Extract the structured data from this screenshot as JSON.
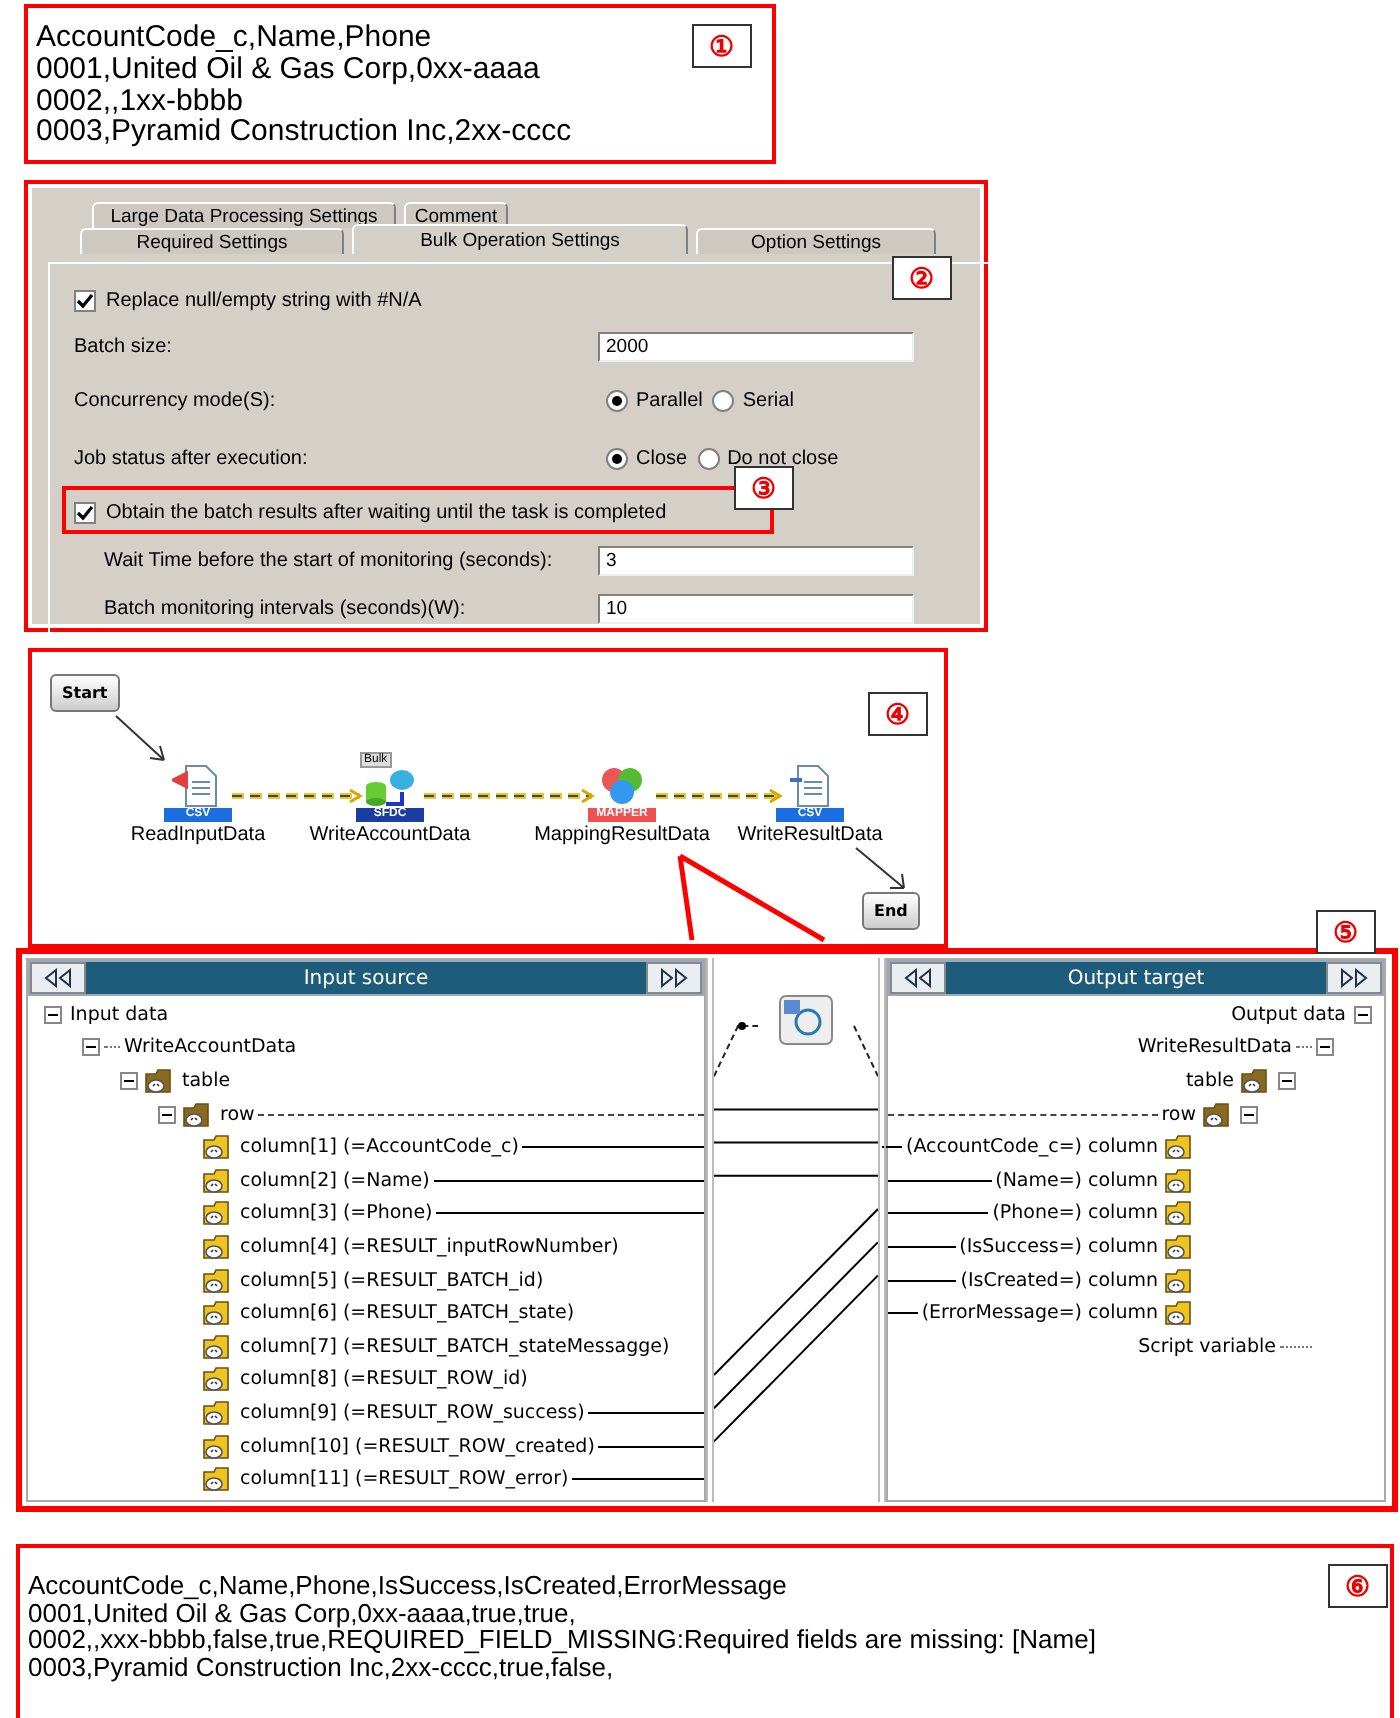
{
  "input_csv": {
    "badge": "①",
    "lines": [
      "AccountCode_c,Name,Phone",
      "0001,United Oil & Gas Corp,0xx-aaaa",
      "0002,,1xx-bbbb",
      "0003,Pyramid Construction Inc,2xx-cccc"
    ]
  },
  "settings": {
    "badge": "②",
    "tabs_back": [
      {
        "label": "Large Data Processing Settings",
        "selected": false
      },
      {
        "label": "Comment",
        "selected": false
      }
    ],
    "tabs_front": [
      {
        "label": "Required Settings",
        "selected": false
      },
      {
        "label": "Bulk Operation Settings",
        "selected": true
      },
      {
        "label": "Option Settings",
        "selected": false
      }
    ],
    "replace_null": {
      "label": "Replace null/empty string with #N/A",
      "checked": true
    },
    "batch_size": {
      "label": "Batch size:",
      "value": "2000"
    },
    "concurrency": {
      "label": "Concurrency mode(S):",
      "options": [
        {
          "label": "Parallel",
          "selected": true
        },
        {
          "label": "Serial",
          "selected": false
        }
      ]
    },
    "job_status": {
      "label": "Job status after execution:",
      "options": [
        {
          "label": "Close",
          "selected": true
        },
        {
          "label": "Do not close",
          "selected": false
        }
      ]
    },
    "obtain_results": {
      "label": "Obtain the batch results after waiting until the task is completed",
      "checked": true,
      "badge": "③"
    },
    "wait_time": {
      "label": "Wait Time before the start of monitoring (seconds):",
      "value": "3"
    },
    "monitor_interval": {
      "label": "Batch monitoring intervals (seconds)(W):",
      "value": "10"
    }
  },
  "flow": {
    "badge": "④",
    "start": "Start",
    "end": "End",
    "nodes": [
      {
        "name": "ReadInputData",
        "tag": "CSV",
        "kind": "csv-read"
      },
      {
        "name": "WriteAccountData",
        "tag": "SFDC",
        "kind": "sfdc",
        "extra": "Bulk"
      },
      {
        "name": "MappingResultData",
        "tag": "MAPPER",
        "kind": "mapper"
      },
      {
        "name": "WriteResultData",
        "tag": "CSV",
        "kind": "csv-write"
      }
    ]
  },
  "mapper": {
    "badge": "⑤",
    "input": {
      "title": "Input source",
      "tree": [
        {
          "label": "Input data",
          "kind": "root",
          "children": [
            {
              "label": "WriteAccountData",
              "kind": "component",
              "children": [
                {
                  "label": "table",
                  "kind": "table",
                  "children": [
                    {
                      "label": "row",
                      "kind": "row",
                      "mapped": true,
                      "children": [
                        {
                          "label": "column[1] (=AccountCode_c)",
                          "kind": "column",
                          "mapped": true
                        },
                        {
                          "label": "column[2] (=Name)",
                          "kind": "column",
                          "mapped": true
                        },
                        {
                          "label": "column[3] (=Phone)",
                          "kind": "column",
                          "mapped": true
                        },
                        {
                          "label": "column[4] (=RESULT_inputRowNumber)",
                          "kind": "column",
                          "mapped": false
                        },
                        {
                          "label": "column[5] (=RESULT_BATCH_id)",
                          "kind": "column",
                          "mapped": false
                        },
                        {
                          "label": "column[6] (=RESULT_BATCH_state)",
                          "kind": "column",
                          "mapped": false
                        },
                        {
                          "label": "column[7] (=RESULT_BATCH_stateMessagge)",
                          "kind": "column",
                          "mapped": false
                        },
                        {
                          "label": "column[8] (=RESULT_ROW_id)",
                          "kind": "column",
                          "mapped": false
                        },
                        {
                          "label": "column[9] (=RESULT_ROW_success)",
                          "kind": "column",
                          "mapped": true
                        },
                        {
                          "label": "column[10] (=RESULT_ROW_created)",
                          "kind": "column",
                          "mapped": true
                        },
                        {
                          "label": "column[11] (=RESULT_ROW_error)",
                          "kind": "column",
                          "mapped": true
                        }
                      ]
                    }
                  ]
                }
              ]
            }
          ]
        }
      ]
    },
    "output": {
      "title": "Output target",
      "tree": [
        {
          "label": "Output data",
          "kind": "root",
          "children": [
            {
              "label": "WriteResultData",
              "kind": "component",
              "children": [
                {
                  "label": "table",
                  "kind": "table",
                  "children": [
                    {
                      "label": "row",
                      "kind": "row",
                      "mapped": true,
                      "children": [
                        {
                          "label": "(AccountCode_c=) column",
                          "kind": "column",
                          "mapped": true
                        },
                        {
                          "label": "(Name=) column",
                          "kind": "column",
                          "mapped": true
                        },
                        {
                          "label": "(Phone=) column",
                          "kind": "column",
                          "mapped": true
                        },
                        {
                          "label": "(IsSuccess=) column",
                          "kind": "column",
                          "mapped": true
                        },
                        {
                          "label": "(IsCreated=) column",
                          "kind": "column",
                          "mapped": true
                        },
                        {
                          "label": "(ErrorMessage=) column",
                          "kind": "column",
                          "mapped": true
                        }
                      ]
                    }
                  ]
                }
              ]
            },
            {
              "label": "Script variable",
              "kind": "variable"
            }
          ]
        }
      ]
    }
  },
  "result_csv": {
    "badge": "⑥",
    "lines": [
      "AccountCode_c,Name,Phone,IsSuccess,IsCreated,ErrorMessage",
      "0001,United Oil & Gas Corp,0xx-aaaa,true,true,",
      "0002,,xxx-bbbb,false,true,REQUIRED_FIELD_MISSING:Required fields are missing: [Name]",
      "0003,Pyramid Construction Inc,2xx-cccc,true,false,"
    ]
  }
}
